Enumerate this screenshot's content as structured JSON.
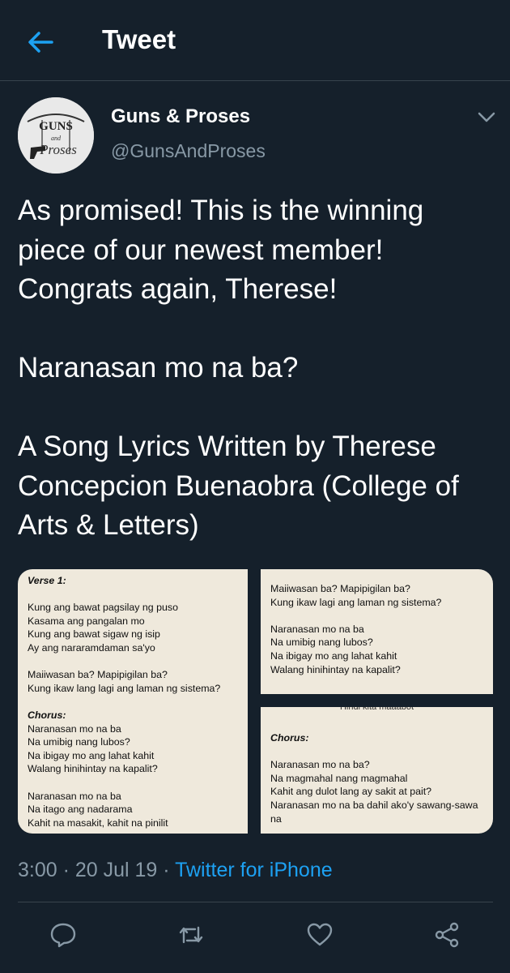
{
  "header": {
    "title": "Tweet"
  },
  "tweet": {
    "display_name": "Guns & Proses",
    "handle": "@GunsAndProses",
    "avatar_text": "GUNS and Proses",
    "text": "As promised! This is the winning piece of our newest member! Congrats again, Therese!\n\nNaranasan mo na ba?\n\nA Song Lyrics Written by Therese Concepcion Buenaobra (College of Arts & Letters)",
    "time": "3:00 · 20 Jul 19 · ",
    "source": "Twitter for iPhone"
  },
  "media": {
    "left": {
      "label": "Verse 1:",
      "verse": "Kung ang bawat pagsilay ng puso\nKasama ang pangalan mo\nKung ang bawat sigaw ng isip\nAy ang nararamdaman sa'yo",
      "question": "Maiiwasan ba? Mapipigilan ba?\nKung ikaw lang lagi ang laman ng sistema?",
      "chorus_label": "Chorus:",
      "chorus": "Naranasan mo na ba\nNa umibig nang lubos?\nNa ibigay mo ang lahat kahit\nWalang hinihintay na kapalit?",
      "chorus2": "Naranasan mo na ba\nNa itago ang nadarama\nKahit na masakit, kahit na pinilit"
    },
    "right_top": {
      "question": "Maiiwasan ba? Mapipigilan ba?\nKung ikaw lagi ang laman ng sistema?",
      "chorus": "Naranasan mo na ba\nNa umibig nang lubos?\nNa ibigay mo ang lahat kahit\nWalang hinihintay na kapalit?"
    },
    "right_bottom": {
      "cut_line": "Hindi kita maaabot",
      "chorus_label": "Chorus:",
      "chorus": "Naranasan mo na ba?\nNa magmahal nang magmahal\nKahit ang dulot lang ay sakit at pait?\nNaranasan mo na ba dahil ako'y sawang-sawa\nna"
    }
  },
  "colors": {
    "background": "#15202b",
    "accent": "#1da1f2",
    "secondary_text": "#8899a6",
    "divider": "#38444d",
    "paper": "#efe9dc"
  },
  "icons": {
    "back": "arrow-left-icon",
    "caret": "chevron-down-icon",
    "reply": "reply-icon",
    "retweet": "retweet-icon",
    "like": "heart-icon",
    "share": "share-icon"
  }
}
